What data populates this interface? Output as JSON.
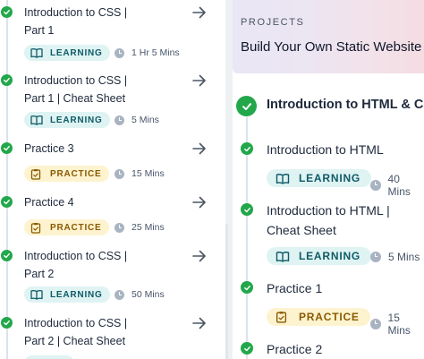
{
  "left_panel": {
    "items": [
      {
        "title_line1": "Introduction to CSS |",
        "title_line2": "Part 1",
        "tag": "LEARNING",
        "duration": "1 Hr 5 Mins"
      },
      {
        "title_line1": "Introduction to CSS |",
        "title_line2": "Part 1 | Cheat Sheet",
        "tag": "LEARNING",
        "duration": "5 Mins"
      },
      {
        "title_line1": "Practice 3",
        "title_line2": "",
        "tag": "PRACTICE",
        "duration": "15 Mins"
      },
      {
        "title_line1": "Practice 4",
        "title_line2": "",
        "tag": "PRACTICE",
        "duration": "25 Mins"
      },
      {
        "title_line1": "Introduction to CSS |",
        "title_line2": "Part 2",
        "tag": "LEARNING",
        "duration": "50 Mins"
      },
      {
        "title_line1": "Introduction to CSS |",
        "title_line2": "Part 2 | Cheat Sheet",
        "tag": "LEARNING",
        "duration": ""
      }
    ]
  },
  "right_panel": {
    "project_label": "PROJECTS",
    "project_title": "Build Your Own Static Website",
    "module_title": "Introduction to HTML & CSS",
    "items": [
      {
        "title_line1": "Introduction to HTML",
        "title_line2": "",
        "tag": "LEARNING",
        "duration": "40 Mins"
      },
      {
        "title_line1": "Introduction to HTML |",
        "title_line2": "Cheat Sheet",
        "tag": "LEARNING",
        "duration": "5 Mins"
      },
      {
        "title_line1": "Practice 1",
        "title_line2": "",
        "tag": "PRACTICE",
        "duration": "15 Mins"
      },
      {
        "title_line1": "Practice 2",
        "title_line2": "",
        "tag": "",
        "duration": ""
      }
    ]
  },
  "icons": {
    "check": "check-circle-icon",
    "arrow": "arrow-right-icon",
    "learning": "book-icon",
    "practice": "clipboard-icon",
    "clock": "clock-icon"
  },
  "colors": {
    "complete_green": "#22a74a",
    "learning_bg": "#dff3f3",
    "learning_text": "#0e5a66",
    "practice_bg": "#fdf3cf",
    "practice_text": "#8a5a00"
  }
}
